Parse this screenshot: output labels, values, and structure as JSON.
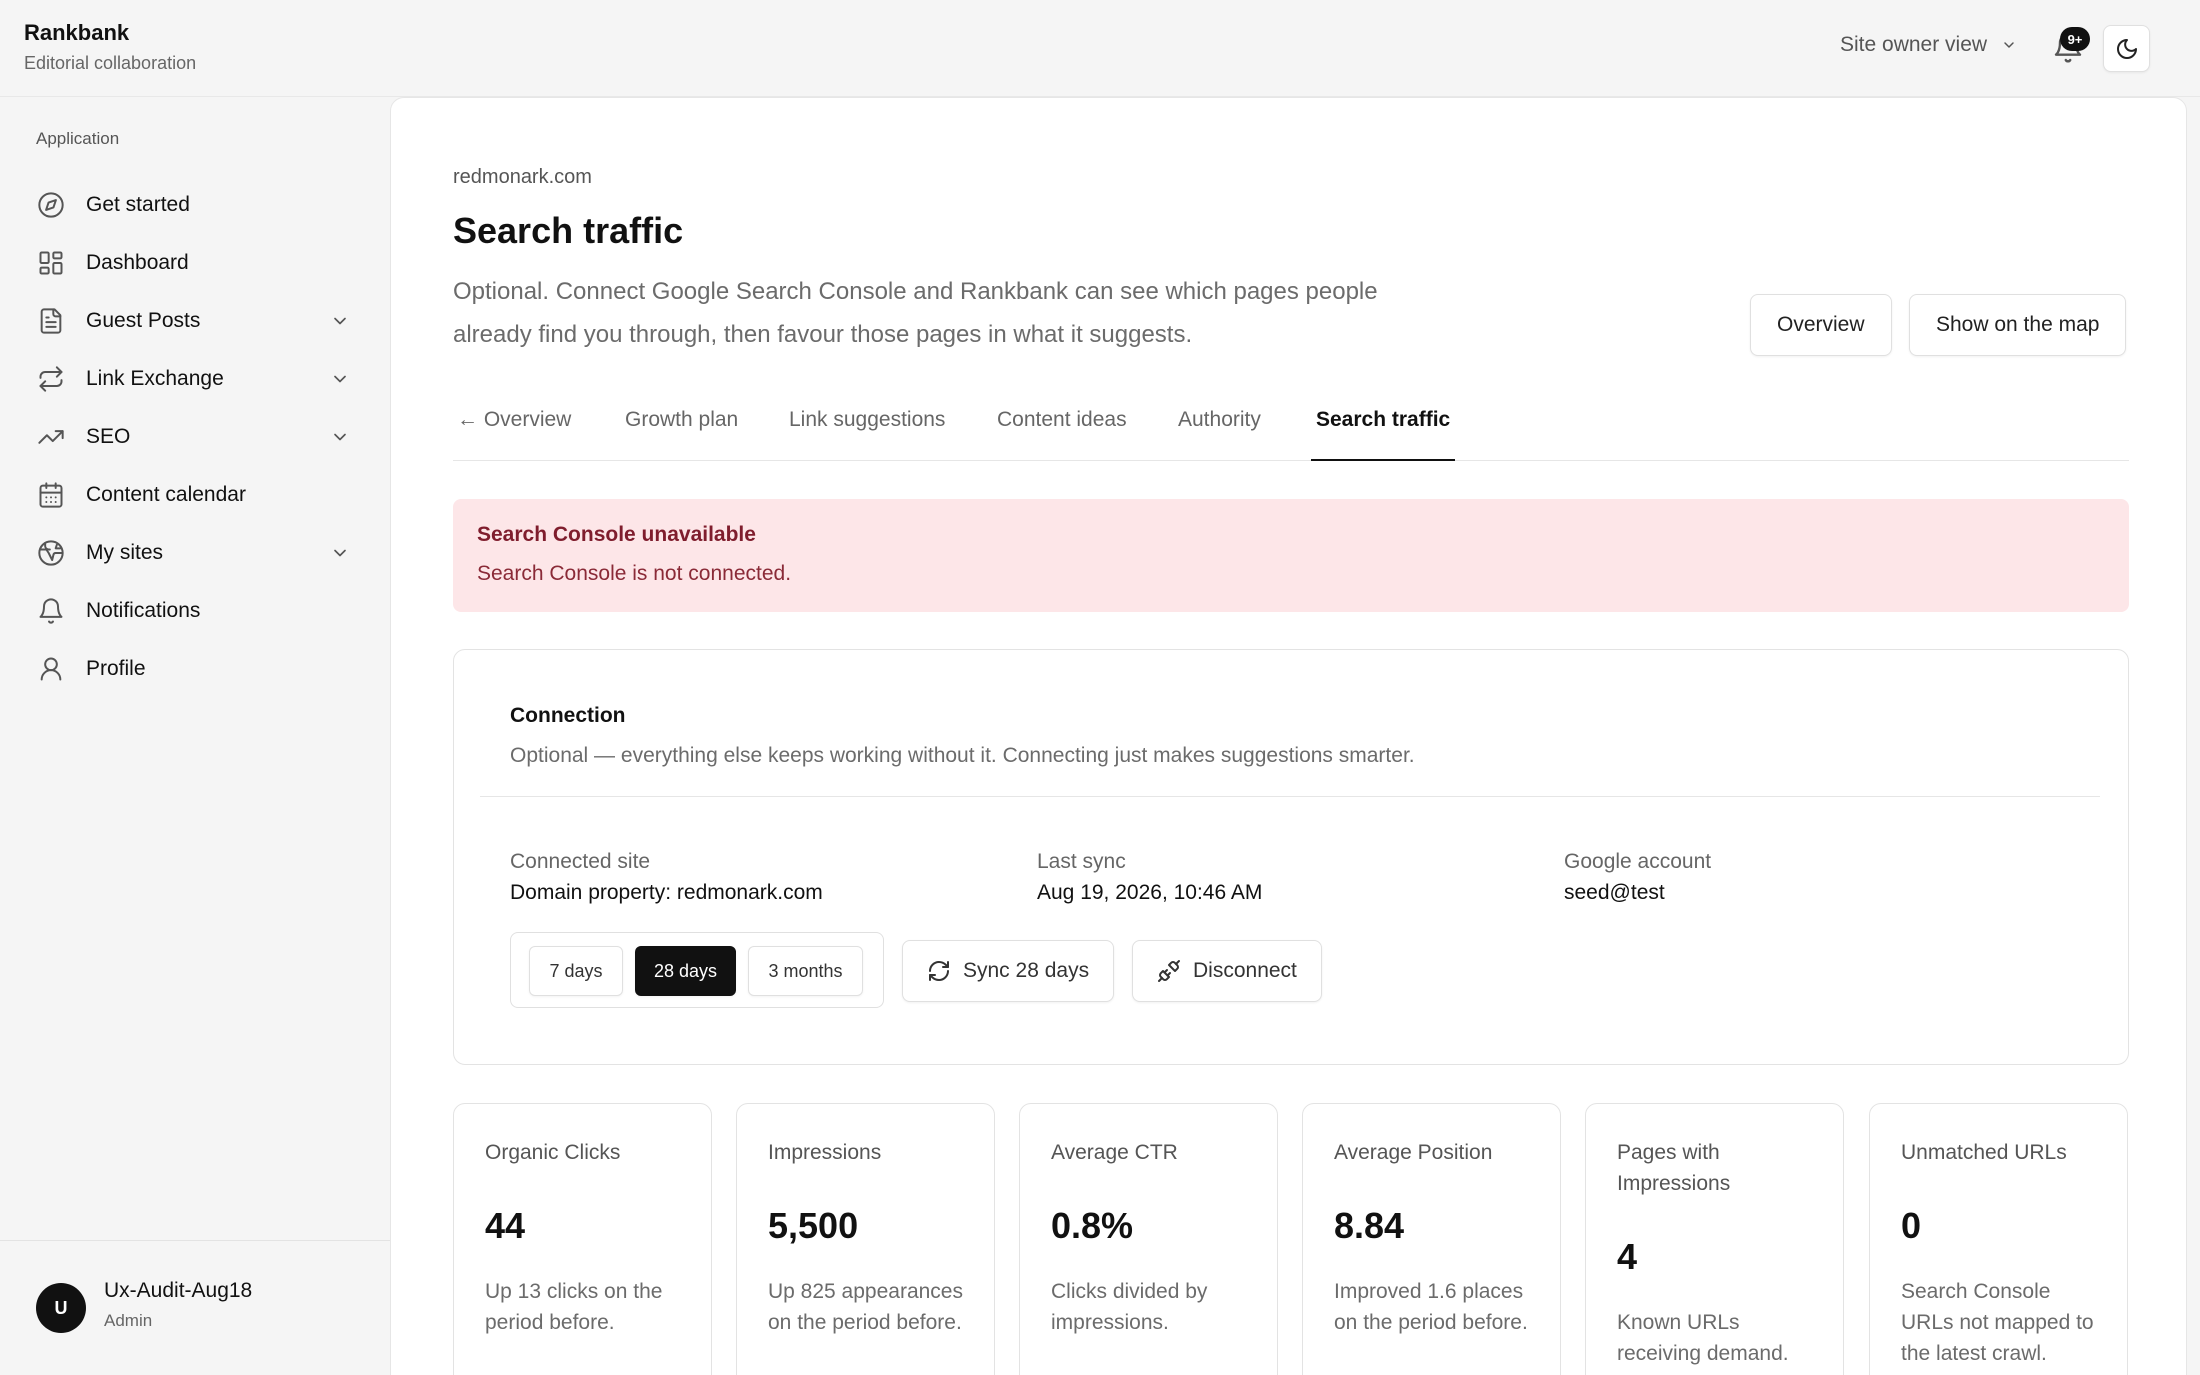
{
  "app": {
    "name": "Rankbank",
    "tagline": "Editorial collaboration"
  },
  "topbar": {
    "view_label": "Site owner view",
    "notification_badge": "9+"
  },
  "sidebar": {
    "section_label": "Application",
    "items": [
      {
        "label": "Get started",
        "icon": "compass-icon",
        "has_children": false
      },
      {
        "label": "Dashboard",
        "icon": "grid-icon",
        "has_children": false
      },
      {
        "label": "Guest Posts",
        "icon": "document-icon",
        "has_children": true
      },
      {
        "label": "Link Exchange",
        "icon": "repeat-icon",
        "has_children": true
      },
      {
        "label": "SEO",
        "icon": "trending-up-icon",
        "has_children": true
      },
      {
        "label": "Content calendar",
        "icon": "calendar-icon",
        "has_children": false
      },
      {
        "label": "My sites",
        "icon": "globe-icon",
        "has_children": true
      },
      {
        "label": "Notifications",
        "icon": "bell-icon",
        "has_children": false
      },
      {
        "label": "Profile",
        "icon": "user-icon",
        "has_children": false
      }
    ],
    "user": {
      "initial": "U",
      "name": "Ux-Audit-Aug18",
      "role": "Admin"
    }
  },
  "page": {
    "breadcrumb": "redmonark.com",
    "title": "Search traffic",
    "description": "Optional. Connect Google Search Console and Rankbank can see which pages people already find you through, then favour those pages in what it suggests.",
    "buttons": {
      "overview": "Overview",
      "map": "Show on the map"
    }
  },
  "tabs": [
    {
      "label": "← Overview",
      "active": false
    },
    {
      "label": "Growth plan",
      "active": false
    },
    {
      "label": "Link suggestions",
      "active": false
    },
    {
      "label": "Content ideas",
      "active": false
    },
    {
      "label": "Authority",
      "active": false
    },
    {
      "label": "Search traffic",
      "active": true
    }
  ],
  "alert": {
    "title": "Search Console unavailable",
    "message": "Search Console is not connected."
  },
  "connection": {
    "title": "Connection",
    "description": "Optional — everything else keeps working without it. Connecting just makes suggestions smarter.",
    "site_label": "Connected site",
    "site_value": "Domain property: redmonark.com",
    "sync_label": "Last sync",
    "sync_value": "Aug 19, 2026, 10:46 AM",
    "account_label": "Google account",
    "account_value": "seed@test",
    "ranges": [
      "7 days",
      "28 days",
      "3 months"
    ],
    "active_range": "28 days",
    "sync_button": "Sync 28 days",
    "disconnect_button": "Disconnect"
  },
  "stats": [
    {
      "label": "Organic Clicks",
      "value": "44",
      "note": "Up 13 clicks on the period before."
    },
    {
      "label": "Impressions",
      "value": "5,500",
      "note": "Up 825 appearances on the period before."
    },
    {
      "label": "Average CTR",
      "value": "0.8%",
      "note": "Clicks divided by impressions."
    },
    {
      "label": "Average Position",
      "value": "8.84",
      "note": "Improved 1.6 places on the period before."
    },
    {
      "label": "Pages with Impressions",
      "value": "4",
      "note": "Known URLs receiving demand."
    },
    {
      "label": "Unmatched URLs",
      "value": "0",
      "note": "Search Console URLs not mapped to the latest crawl."
    }
  ],
  "colors": {
    "alert_bg": "#fde6e8",
    "alert_text": "#7f1d2d",
    "accent": "#111111"
  }
}
